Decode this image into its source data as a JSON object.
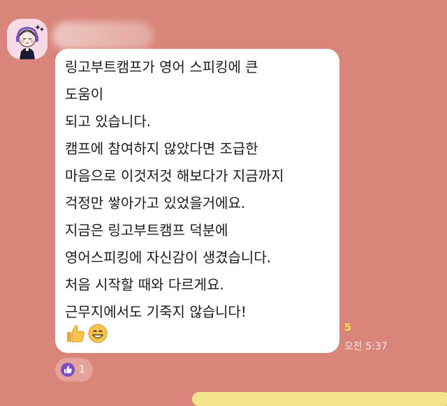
{
  "chat": {
    "sender_name": "",
    "message_lines": [
      "링고부트캠프가 영어 스피킹에 큰",
      "도움이",
      "되고 있습니다.",
      "캠프에 참여하지 않았다면 조급한",
      "마음으로 이것저것 해보다가 지금까지",
      "걱정만 쌓아가고 있었을거에요.",
      "지금은 링고부트캠프 덕분에",
      "영어스피킹에 자신감이 생겼습니다.",
      "처음 시작할 때와  다르게요.",
      "근무지에서도 기죽지 않습니다!"
    ],
    "emojis": [
      "thumbs-up-icon",
      "grinning-face-icon"
    ],
    "unread_count": "5",
    "timestamp": "오전 5:37",
    "reaction": {
      "icon": "thumbs-up-icon",
      "count": "1"
    }
  },
  "colors": {
    "background": "#d98579",
    "bubble": "#ffffff",
    "unread": "#f3e24a",
    "reaction_badge": "#7b4fc9"
  }
}
